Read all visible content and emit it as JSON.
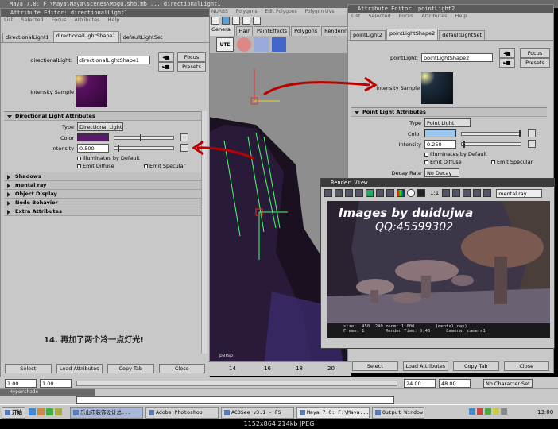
{
  "top_title": "Maya 7.0: F:\\Maya\\Maya\\scenes\\Mogu.shb.mb ... directionalLight1",
  "viewport_menu": [
    "NURBS",
    "Polygons",
    "Edit Polygons",
    "Polygon UVs"
  ],
  "shelf_tabs": [
    "General",
    "Hair",
    "PaintEffects",
    "Polygons",
    "Rendering"
  ],
  "shelf_icon_label": "UTE",
  "viewport_label": "persp",
  "timeline": {
    "ticks": [
      "14",
      "16",
      "18",
      "20"
    ]
  },
  "left_editor": {
    "title": "Attribute Editor: directionalLight1",
    "menu": [
      "List",
      "Selected",
      "Focus",
      "Attributes",
      "Help"
    ],
    "tabs": [
      "directionalLight1",
      "directionalLightShape1",
      "defaultLightSet"
    ],
    "node_label": "directionalLight:",
    "node_value": "directionalLightShape1",
    "focus_label": "Focus",
    "presets_label": "Presets",
    "intensity_sample_label": "Intensity Sample",
    "section_title": "Directional Light Attributes",
    "type_label": "Type",
    "type_value": "Directional Light",
    "color_label": "Color",
    "intensity_label": "Intensity",
    "intensity_value": "0.500",
    "illuminates_label": "Illuminates by Default",
    "diffuse_label": "Emit Diffuse",
    "specular_label": "Emit Specular",
    "sections": [
      "Shadows",
      "mental ray",
      "Object Display",
      "Node Behavior",
      "Extra Attributes"
    ],
    "annotation": "14. 再加了两个冷一点灯光!",
    "buttons": [
      "Select",
      "Load Attributes",
      "Copy Tab",
      "Close"
    ],
    "light_color": "#5a1a6e"
  },
  "right_editor": {
    "title": "Attribute Editor: pointLight2",
    "menu": [
      "List",
      "Selected",
      "Focus",
      "Attributes",
      "Help"
    ],
    "tabs": [
      "pointLight2",
      "pointLightShape2",
      "defaultLightSet"
    ],
    "node_label": "pointLight:",
    "node_value": "pointLightShape2",
    "focus_label": "Focus",
    "presets_label": "Presets",
    "intensity_sample_label": "Intensity Sample",
    "section_title": "Point Light Attributes",
    "type_label": "Type",
    "type_value": "Point Light",
    "color_label": "Color",
    "intensity_label": "Intensity",
    "intensity_value": "0.250",
    "illuminates_label": "Illuminates by Default",
    "diffuse_label": "Emit Diffuse",
    "specular_label": "Emit Specular",
    "decay_label": "Decay Rate",
    "decay_value": "No Decay",
    "buttons": [
      "Select",
      "Load Attributes",
      "Copy Tab",
      "Close"
    ],
    "light_color": "#9cc8f0"
  },
  "render_view": {
    "title": "Render View",
    "renderer": "mental ray",
    "ratio": "1:1",
    "watermark_line1": "Images by duidujwa",
    "watermark_line2": "QQ:45599302",
    "status_line1": "size:  450  240 zoom: 1.000        (mental ray)",
    "status_line2": "Frame: 1        Render Time: 0:46      Camera: camera1"
  },
  "range_bar": {
    "start": "1.00",
    "current": "1.00",
    "end_a": "24.00",
    "end_b": "48.00",
    "character_set": "No Character Set"
  },
  "hypershade_title": "Hypershade",
  "taskbar": {
    "start_label": "开始",
    "buttons": [
      "乐山市装饰设计总...",
      "Adobe Photoshop",
      "ACDSee v3.1 - FS",
      "Maya 7.0: F:\\Maya...",
      "Output Window"
    ],
    "clock": "13:00"
  },
  "caption": "1152x864  214kb  JPEG"
}
